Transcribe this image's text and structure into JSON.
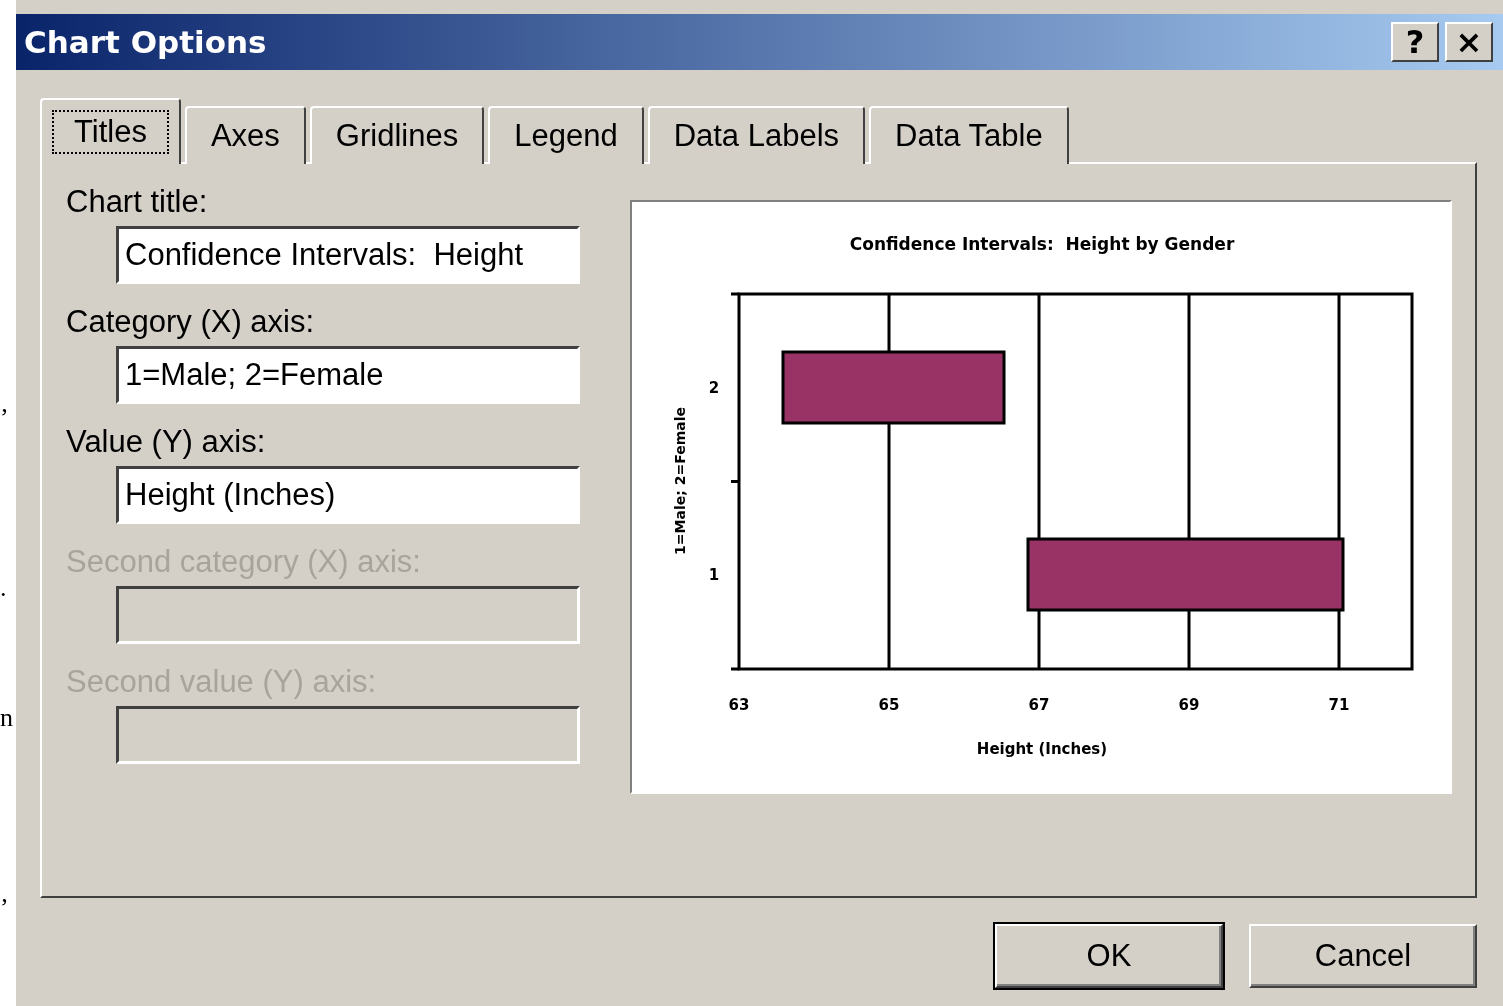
{
  "background_text": [
    "’",
    ".",
    "n",
    "’"
  ],
  "window": {
    "title": "Chart Options",
    "help_button": "?",
    "close_button": "×"
  },
  "tabs": [
    {
      "label": "Titles",
      "selected": true
    },
    {
      "label": "Axes",
      "selected": false
    },
    {
      "label": "Gridlines",
      "selected": false
    },
    {
      "label": "Legend",
      "selected": false
    },
    {
      "label": "Data Labels",
      "selected": false
    },
    {
      "label": "Data Table",
      "selected": false
    }
  ],
  "fields": [
    {
      "label": "Chart title:",
      "value": "Confidence Intervals:  Height",
      "disabled": false
    },
    {
      "label": "Category (X) axis:",
      "value": "1=Male; 2=Female",
      "disabled": false
    },
    {
      "label": "Value (Y) axis:",
      "value": "Height (Inches)",
      "disabled": false
    },
    {
      "label": "Second category (X) axis:",
      "disabled": true
    },
    {
      "label": "Second value (Y) axis:",
      "disabled": true
    }
  ],
  "preview": {
    "title": "Confidence Intervals:  Height by Gender",
    "ylabel": "1=Male; 2=Female",
    "xlabel": "Height (Inches)",
    "y_tick_labels": [
      "2",
      "1"
    ],
    "x_tick_labels": [
      "63",
      "65",
      "67",
      "69",
      "71"
    ]
  },
  "buttons": [
    "OK",
    "Cancel"
  ]
}
